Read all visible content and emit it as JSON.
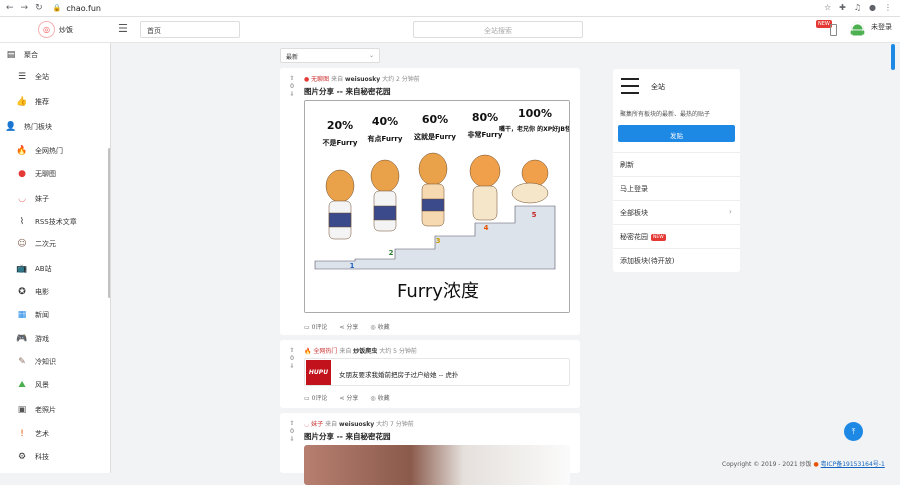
{
  "browser": {
    "url": "chao.fun"
  },
  "header": {
    "brand": "炒饭",
    "home_tab": "首页",
    "search_placeholder": "全站搜索",
    "new_badge": "NEW",
    "login": "未登录"
  },
  "sidebar": {
    "items": [
      {
        "label": "聚合",
        "icon": "aggregate-icon",
        "glyph": "▤",
        "color": "#333"
      },
      {
        "label": "全站",
        "icon": "list-icon",
        "glyph": "☰",
        "color": "#333"
      },
      {
        "label": "推荐",
        "icon": "thumbs-up-icon",
        "glyph": "👍",
        "color": "#333"
      },
      {
        "label": "热门板块",
        "icon": "user-icon",
        "glyph": "👤",
        "color": "#333"
      },
      {
        "label": "全网热门",
        "icon": "fire-icon",
        "glyph": "🔥",
        "color": "#e65100"
      },
      {
        "label": "无聊图",
        "icon": "reddit-icon",
        "glyph": "●",
        "color": "#e53935"
      },
      {
        "label": "妹子",
        "icon": "lips-icon",
        "glyph": "◡",
        "color": "#e57373"
      },
      {
        "label": "RSS技术文章",
        "icon": "rss-icon",
        "glyph": "⌇",
        "color": "#333"
      },
      {
        "label": "二次元",
        "icon": "anime-icon",
        "glyph": "☺",
        "color": "#795548"
      },
      {
        "label": "AB站",
        "icon": "tv-icon",
        "glyph": "📺",
        "color": "#333"
      },
      {
        "label": "电影",
        "icon": "film-icon",
        "glyph": "✪",
        "color": "#333"
      },
      {
        "label": "新闻",
        "icon": "news-icon",
        "glyph": "▦",
        "color": "#1e88e5"
      },
      {
        "label": "游戏",
        "icon": "gamepad-icon",
        "glyph": "🎮",
        "color": "#333"
      },
      {
        "label": "冷知识",
        "icon": "lightbulb-icon",
        "glyph": "✎",
        "color": "#8d6e63"
      },
      {
        "label": "风景",
        "icon": "landscape-icon",
        "glyph": "⛰",
        "color": "#4caf50"
      },
      {
        "label": "老照片",
        "icon": "photo-icon",
        "glyph": "▣",
        "color": "#555"
      },
      {
        "label": "艺术",
        "icon": "art-icon",
        "glyph": "!",
        "color": "#e65100"
      },
      {
        "label": "科技",
        "icon": "gear-icon",
        "glyph": "⚙",
        "color": "#333"
      }
    ]
  },
  "feed": {
    "sort": "最新",
    "posts": [
      {
        "votes": "0",
        "source": "无聊图",
        "via": "来自",
        "author": "weisuosky",
        "time": "大约 2 分钟前",
        "title": "图片分享 -- 来自秘密花园",
        "comments": "0评论",
        "share": "分享",
        "save": "收藏",
        "image": {
          "levels": [
            {
              "pct": "20%",
              "caption": "不是Furry",
              "step": "1"
            },
            {
              "pct": "40%",
              "caption": "有点Furry",
              "step": "2"
            },
            {
              "pct": "60%",
              "caption": "这就是Furry",
              "step": "3"
            },
            {
              "pct": "80%",
              "caption": "非常Furry",
              "step": "4"
            },
            {
              "pct": "100%",
              "caption": "嘴干，老兄你\n的XP好JB怪",
              "step": "5"
            }
          ],
          "footer": "Furry浓度"
        }
      },
      {
        "votes": "0",
        "source": "全网热门",
        "via": "来自",
        "author": "炒饭爬虫",
        "time": "大约 5 分钟前",
        "link_logo": "HUPU",
        "link_title": "女朋友要求我婚前把房子过户给她 -- 虎扑",
        "comments": "0评论",
        "share": "分享",
        "save": "收藏"
      },
      {
        "votes": "0",
        "source": "妹子",
        "via": "来自",
        "author": "weisuosky",
        "time": "大约 7 分钟前",
        "title": "图片分享 -- 来自秘密花园"
      }
    ]
  },
  "right_panel": {
    "title": "全站",
    "desc": "聚集所有板块的最新、最热的贴子",
    "post_button": "发贴",
    "items": [
      {
        "label": "刷新"
      },
      {
        "label": "马上登录"
      },
      {
        "label": "全部板块",
        "chevron": "›"
      },
      {
        "label": "秘密花园",
        "badge": "NEW"
      },
      {
        "label": "添加板块(待开放)"
      }
    ]
  },
  "footer": {
    "copyright": "Copyright © 2019 - 2021 炒饭",
    "icp": "粤ICP备19153164号-1"
  },
  "colors": {
    "accent": "#1e88e5",
    "badge": "#e53935"
  }
}
